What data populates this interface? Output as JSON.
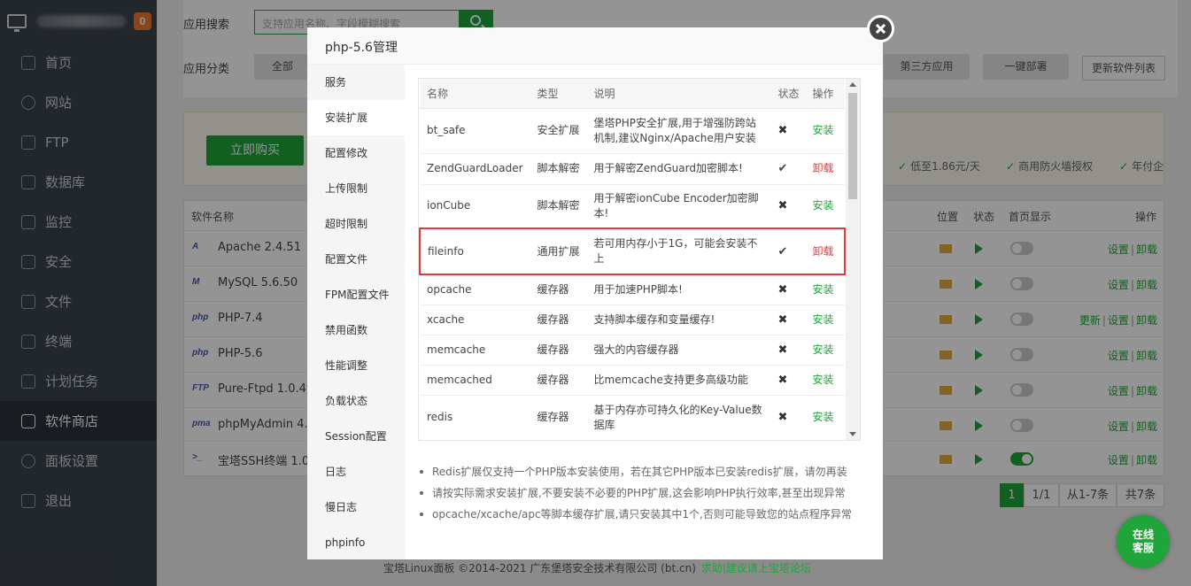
{
  "sidebar": {
    "badge": "0",
    "items": [
      {
        "label": "首页",
        "icon": "home-icon"
      },
      {
        "label": "网站",
        "icon": "globe-icon"
      },
      {
        "label": "FTP",
        "icon": "ftp-icon"
      },
      {
        "label": "数据库",
        "icon": "database-icon"
      },
      {
        "label": "监控",
        "icon": "monitor-icon"
      },
      {
        "label": "安全",
        "icon": "shield-icon"
      },
      {
        "label": "文件",
        "icon": "folder-icon"
      },
      {
        "label": "终端",
        "icon": "terminal-icon"
      },
      {
        "label": "计划任务",
        "icon": "calendar-icon"
      },
      {
        "label": "软件商店",
        "icon": "apps-icon",
        "active": true
      },
      {
        "label": "面板设置",
        "icon": "gear-icon"
      },
      {
        "label": "退出",
        "icon": "logout-icon"
      }
    ]
  },
  "store": {
    "search_label": "应用搜索",
    "search_placeholder": "支持应用名称、字段模糊搜索",
    "category_label": "应用分类",
    "cat_all": "全部",
    "cat_third": "第三方应用",
    "cat_oneclick": "一键部署",
    "update_list": "更新软件列表",
    "buy_now": "立即购买",
    "perks": [
      "低至1.86元/天",
      "商用防火墙授权",
      "年付企"
    ],
    "headers": {
      "name": "软件名称",
      "location": "位置",
      "status": "状态",
      "homepage": "首页显示",
      "ops": "操作"
    },
    "rows": [
      {
        "name": "Apache 2.4.51",
        "icon": "A",
        "ops": [
          "设置",
          "卸载"
        ],
        "home": false
      },
      {
        "name": "MySQL 5.6.50",
        "icon": "M",
        "ops": [
          "设置",
          "卸载"
        ],
        "home": false
      },
      {
        "name": "PHP-7.4",
        "icon": "php",
        "ops": [
          "更新",
          "设置",
          "卸载"
        ],
        "home": false
      },
      {
        "name": "PHP-5.6",
        "icon": "php",
        "ops": [
          "设置",
          "卸载"
        ],
        "home": false
      },
      {
        "name": "Pure-Ftpd 1.0.49",
        "icon": "FTP",
        "ops": [
          "设置",
          "卸载"
        ],
        "home": false
      },
      {
        "name": "phpMyAdmin 4.4",
        "icon": "pma",
        "ops": [
          "设置",
          "卸载"
        ],
        "home": false
      },
      {
        "name": "宝塔SSH终端 1.0",
        "icon": ">_",
        "ops": [
          "设置",
          "卸载"
        ],
        "home": true
      }
    ],
    "pager": {
      "current": "1",
      "pages": "1/1",
      "range": "从1-7条",
      "total": "共7条"
    }
  },
  "modal": {
    "title": "php-5.6管理",
    "menu": [
      "服务",
      "安装扩展",
      "配置修改",
      "上传限制",
      "超时限制",
      "配置文件",
      "FPM配置文件",
      "禁用函数",
      "性能调整",
      "负载状态",
      "Session配置",
      "日志",
      "慢日志",
      "phpinfo"
    ],
    "active_menu": 1,
    "table_headers": {
      "name": "名称",
      "type": "类型",
      "desc": "说明",
      "status": "状态",
      "action": "操作"
    },
    "extensions": [
      {
        "name": "bt_safe",
        "type": "安全扩展",
        "desc": "堡塔PHP安全扩展,用于增强防跨站机制,建议Nginx/Apache用户安装",
        "installed": false,
        "action": "安装"
      },
      {
        "name": "ZendGuardLoader",
        "type": "脚本解密",
        "desc": "用于解密ZendGuard加密脚本!",
        "installed": true,
        "action": "卸载"
      },
      {
        "name": "ionCube",
        "type": "脚本解密",
        "desc": "用于解密ionCube Encoder加密脚本!",
        "installed": false,
        "action": "安装"
      },
      {
        "name": "fileinfo",
        "type": "通用扩展",
        "desc": "若可用内存小于1G，可能会安装不上",
        "installed": true,
        "action": "卸载",
        "highlight": true
      },
      {
        "name": "opcache",
        "type": "缓存器",
        "desc": "用于加速PHP脚本!",
        "installed": false,
        "action": "安装"
      },
      {
        "name": "xcache",
        "type": "缓存器",
        "desc": "支持脚本缓存和变量缓存!",
        "installed": false,
        "action": "安装"
      },
      {
        "name": "memcache",
        "type": "缓存器",
        "desc": "强大的内容缓存器",
        "installed": false,
        "action": "安装"
      },
      {
        "name": "memcached",
        "type": "缓存器",
        "desc": "比memcache支持更多高级功能",
        "installed": false,
        "action": "安装"
      },
      {
        "name": "redis",
        "type": "缓存器",
        "desc": "基于内存亦可持久化的Key-Value数据库",
        "installed": false,
        "action": "安装"
      }
    ],
    "tips": [
      "Redis扩展仅支持一个PHP版本安装使用，若在其它PHP版本已安装redis扩展，请勿再装",
      "请按实际需求安装扩展,不要安装不必要的PHP扩展,这会影响PHP执行效率,甚至出现异常",
      "opcache/xcache/apc等脚本缓存扩展,请只安装其中1个,否则可能导致您的站点程序异常"
    ]
  },
  "footer": {
    "copyright": "宝塔Linux面板 ©2014-2021 广东堡塔安全技术有限公司 (bt.cn)",
    "link": "求助|建议请上宝塔论坛"
  },
  "chat": {
    "label": "在线客服"
  },
  "colors": {
    "accent": "#20a53a",
    "danger": "#e23a3a",
    "sidebar": "#3c444d"
  }
}
